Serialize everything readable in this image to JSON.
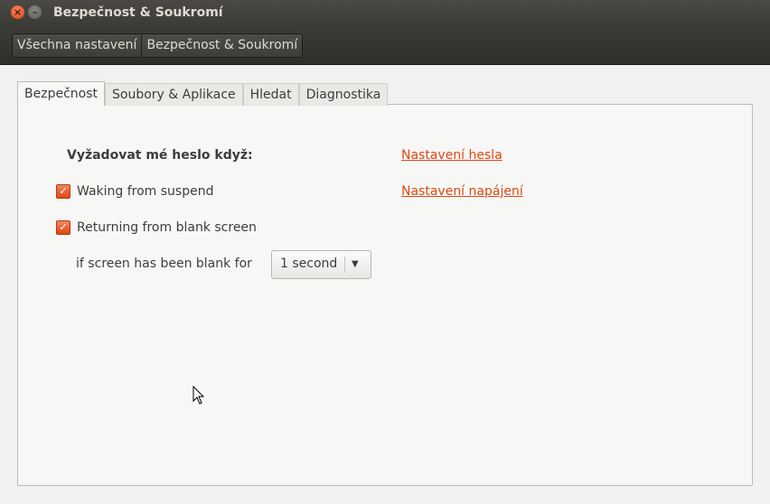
{
  "window": {
    "title": "Bezpečnost & Soukromí",
    "close_glyph": "×",
    "minimize_glyph": "–"
  },
  "breadcrumbs": [
    "Všechna nastavení",
    "Bezpečnost & Soukromí"
  ],
  "tabs": [
    {
      "label": "Bezpečnost",
      "active": true
    },
    {
      "label": "Soubory & Aplikace",
      "active": false
    },
    {
      "label": "Hledat",
      "active": false
    },
    {
      "label": "Diagnostika",
      "active": false
    }
  ],
  "security": {
    "heading": "Vyžadovat mé heslo když:",
    "options": [
      {
        "label": "Waking from suspend",
        "checked": true
      },
      {
        "label": "Returning from blank screen",
        "checked": true
      }
    ],
    "blank_label": "if screen has been blank for",
    "blank_select": {
      "value": "1 second"
    },
    "links": {
      "password": "Nastavení hesla",
      "power": "Nastavení napájení"
    }
  },
  "colors": {
    "accent": "#dd4814",
    "titlebar": "#3c3b37"
  },
  "icons": {
    "check": "✓",
    "dropdown": "▼"
  }
}
